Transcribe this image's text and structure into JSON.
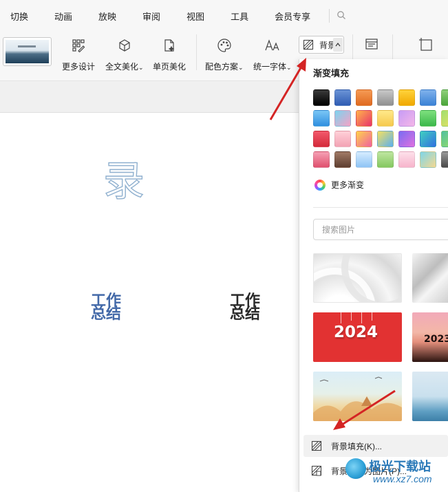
{
  "menubar": {
    "items": [
      "切换",
      "动画",
      "放映",
      "审阅",
      "视图",
      "工具",
      "会员专享"
    ]
  },
  "ribbon": {
    "more_design": "更多设计",
    "full_beautify": "全文美化",
    "page_beautify": "单页美化",
    "color_scheme": "配色方案",
    "unify_font": "统一字体",
    "background": "背景"
  },
  "slide": {
    "char": "录",
    "title1": "工作总结",
    "title2": "工作总结"
  },
  "dropdown": {
    "gradient_title": "渐变填充",
    "more_gradient": "更多渐变",
    "search_placeholder": "搜索图片",
    "img3_year": "2024",
    "img4_year": "2023",
    "bg_fill": "背景填充(K)...",
    "save_bg": "背景另存为图片(P)..."
  },
  "watermark": {
    "name": "极光下载站",
    "url": "www.xz7.com"
  },
  "colors": {
    "accent_blue": "#4369a8",
    "arrow_red": "#d42424",
    "red_tile": "#e23232"
  }
}
